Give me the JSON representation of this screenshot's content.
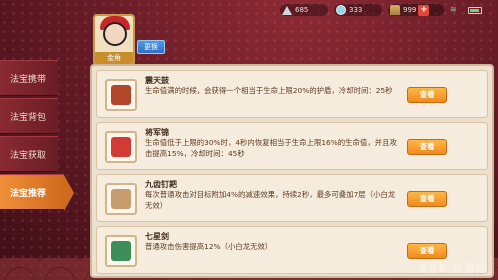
{
  "status": {
    "stamina": "685",
    "diamond": "333",
    "coins": "999"
  },
  "avatar": {
    "tag": "金角",
    "swap_label": "更换"
  },
  "menu": [
    {
      "label": "法宝携带",
      "active": false
    },
    {
      "label": "法宝背包",
      "active": false
    },
    {
      "label": "法宝获取",
      "active": false
    },
    {
      "label": "法宝推荐",
      "active": true
    }
  ],
  "items": [
    {
      "name": "震天鼓",
      "desc": "生命值满的时候，会获得一个相当于生命上限20%的护盾，冷却时间：25秒",
      "button": "查看",
      "thumb_color": "#b2462a"
    },
    {
      "name": "将军锦",
      "desc": "生命值低于上限的30%时，4秒内恢复相当于生命上限16%的生命值，并且攻击提高15%，冷却时间：45秒",
      "button": "查看",
      "thumb_color": "#d23a36"
    },
    {
      "name": "九齿钉耙",
      "desc": "每次普通攻击对目标附加4%的减速效果，持续2秒，最多可叠加7层（小白龙无效）",
      "button": "查看",
      "thumb_color": "#c69c6e"
    },
    {
      "name": "七星剑",
      "desc": "普通攻击伤害提高12%（小白龙无效）",
      "button": "查看",
      "thumb_color": "#3d8f5a"
    }
  ],
  "watermark": "3ㅐE 当游网"
}
